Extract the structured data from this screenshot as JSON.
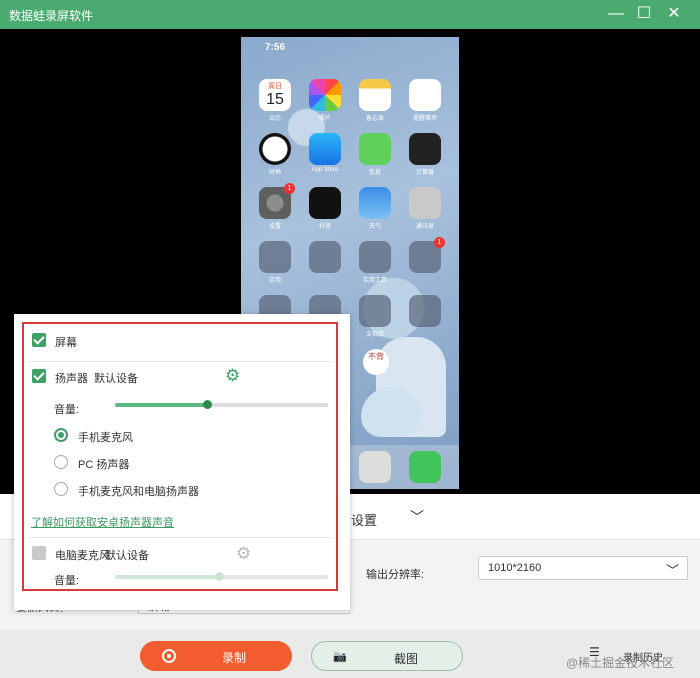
{
  "window": {
    "title": "数据蛙录屏软件",
    "minimize": "—",
    "maximize": "☐",
    "close": "✕"
  },
  "phone": {
    "time": "7:56",
    "calendar": {
      "weekday": "周日",
      "day": "15"
    },
    "apps": [
      {
        "label": "日历"
      },
      {
        "label": "照片"
      },
      {
        "label": "备忘录"
      },
      {
        "label": "提醒事项"
      },
      {
        "label": "时钟"
      },
      {
        "label": "App Store"
      },
      {
        "label": "信息"
      },
      {
        "label": "计算器"
      },
      {
        "label": "设置",
        "badge": "1"
      },
      {
        "label": "抖音"
      },
      {
        "label": "天气"
      },
      {
        "label": "通讯录"
      },
      {
        "label": "实用"
      },
      {
        "label": ""
      },
      {
        "label": "实用工具"
      },
      {
        "label": "",
        "badge": "1"
      },
      {
        "label": ""
      },
      {
        "label": ""
      },
      {
        "label": "文档库"
      },
      {
        "label": ""
      }
    ],
    "sticker_text": "不背"
  },
  "popup": {
    "screen": {
      "label": "屏幕",
      "checked": true
    },
    "speaker": {
      "label": "扬声器",
      "device": "默认设备",
      "checked": true
    },
    "speaker_volume": {
      "label": "音量:",
      "level": 0.43
    },
    "sources": [
      {
        "label": "手机麦克风",
        "selected": true
      },
      {
        "label": "PC 扬声器",
        "selected": false
      },
      {
        "label": "手机麦克风和电脑扬声器",
        "selected": false
      }
    ],
    "help_link": "了解如何获取安卓扬声器声音",
    "mic": {
      "label": "电脑麦克风",
      "device": "默认设备",
      "checked": false
    },
    "mic_volume": {
      "label": "音量:",
      "level": 0.49
    }
  },
  "settings": {
    "tab_label": "设置",
    "chevron": "﹀",
    "resolution_label": "输出分辨率:",
    "resolution_value": "1010*2160",
    "mode_label": "录制内容:",
    "mode_value": "屏幕"
  },
  "actions": {
    "record_label": "录制",
    "screenshot_label": "截图",
    "history_label": "录制历史"
  },
  "watermark": "@稀土掘金技术社区",
  "colors": {
    "accent": "#4aaa70",
    "record": "#f25c2f",
    "highlight": "#d8373f"
  }
}
